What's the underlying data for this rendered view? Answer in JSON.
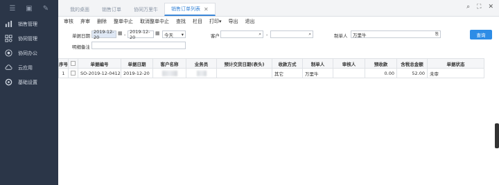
{
  "sidebar": {
    "top_icons": [
      "menu-icon",
      "box-icon",
      "edit-icon"
    ],
    "items": [
      {
        "label": "销售管理",
        "icon": "chart-icon"
      },
      {
        "label": "协同管理",
        "icon": "grid-icon"
      },
      {
        "label": "协同办公",
        "icon": "office-icon"
      },
      {
        "label": "云应用",
        "icon": "cloud-icon"
      },
      {
        "label": "基础设置",
        "icon": "settings-icon"
      }
    ]
  },
  "tabs": [
    {
      "label": "我的桌面"
    },
    {
      "label": "销售订单"
    },
    {
      "label": "协同万里牛"
    },
    {
      "label": "销售订单列表",
      "close": "✕"
    }
  ],
  "toolbar": [
    "审核",
    "弃审",
    "删除",
    "整单中止",
    "取消整单中止",
    "查找",
    "栏目",
    "打印▾",
    "导出",
    "退出"
  ],
  "filters": {
    "date_label": "单据日期",
    "date_from": "2019-12-20",
    "date_to": "2019-12-20",
    "date_range": "今天",
    "customer_label": "客户",
    "customer_sep": "-",
    "creator_label": "制单人",
    "creator_value": "万里牛",
    "note_label": "明细备注",
    "query_button": "查询"
  },
  "table": {
    "headers": [
      "序号",
      "",
      "单据编号",
      "单据日期",
      "客户名称",
      "业务员",
      "预计交货日期(表头)",
      "收款方式",
      "制单人",
      "审核人",
      "预收款",
      "含税总金额",
      "单据状态"
    ],
    "rows": [
      {
        "index": "1",
        "order_no": "SO-2019-12-0412",
        "date": "2019-12-20",
        "payment": "其它",
        "creator": "万里牛",
        "reviewer": "",
        "prepaid": "0.00",
        "total": "52.00",
        "status": "未审"
      }
    ]
  }
}
